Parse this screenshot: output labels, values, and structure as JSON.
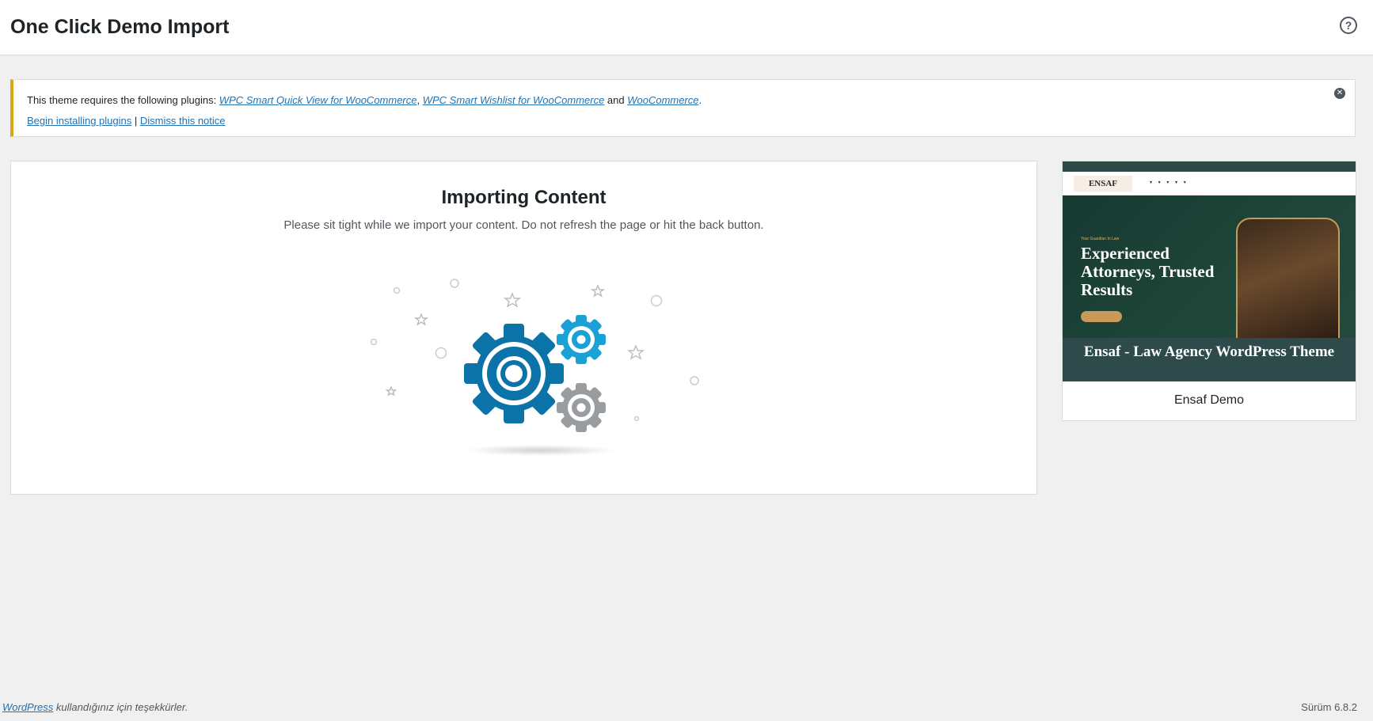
{
  "header": {
    "title": "One Click Demo Import",
    "help_label": "?"
  },
  "notice": {
    "prefix": "This theme requires the following plugins: ",
    "plugins": [
      "WPC Smart Quick View for WooCommerce",
      "WPC Smart Wishlist for WooCommerce",
      "WooCommerce"
    ],
    "sep_comma": ", ",
    "sep_and": " and ",
    "suffix": ".",
    "begin_link": "Begin installing plugins",
    "pipe": " | ",
    "dismiss_link": "Dismiss this notice",
    "accent_color": "#dba617"
  },
  "import": {
    "title": "Importing Content",
    "description": "Please sit tight while we import your content. Do not refresh the page or hit the back button."
  },
  "demo": {
    "preview": {
      "logo": "ENSAF",
      "eyebrow": "Your Guardian In Law",
      "headline": "Experienced Attorneys, Trusted Results",
      "footer_title": "Ensaf - Law Agency WordPress Theme"
    },
    "name": "Ensaf Demo"
  },
  "footer": {
    "wp_link": "WordPress",
    "thanks": " kullandığınız için teşekkürler.",
    "version": "Sürüm 6.8.2"
  },
  "colors": {
    "gear_dark_blue": "#0b73a8",
    "gear_light_blue": "#1aa1d6",
    "gear_gray": "#9a9da0"
  }
}
